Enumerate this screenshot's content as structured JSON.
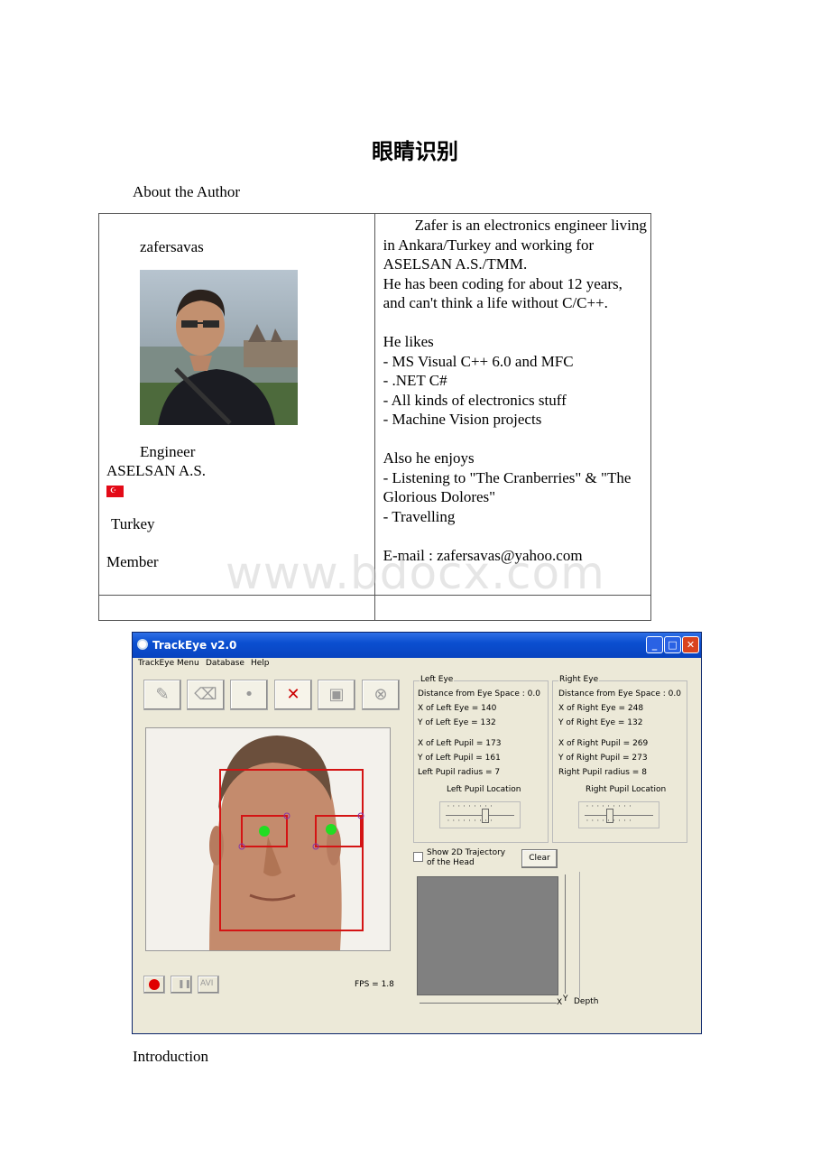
{
  "doc": {
    "title": "眼睛识别",
    "about_heading": "About the Author",
    "intro_heading": "Introduction",
    "watermark": "www.bdocx.com"
  },
  "author": {
    "username": "zafersavas",
    "job": "Engineer",
    "company": "ASELSAN A.S.",
    "country": "Turkey",
    "role": "Member",
    "bio": [
      "Zafer is an electronics engineer living in Ankara/Turkey and working for ASELSAN A.S./TMM.",
      "He has been coding for about 12 years, and can't think a life without C/C++.",
      "He likes",
      "- MS Visual C++ 6.0 and MFC",
      "- .NET C#",
      "- All kinds of electronics stuff",
      "- Machine Vision projects",
      "Also he enjoys",
      "- Listening to \"The Cranberries\" & \"The Glorious Dolores\"",
      "- Travelling",
      "E-mail : zafersavas@yahoo.com"
    ]
  },
  "app": {
    "title": "TrackEye v2.0",
    "menu": [
      "TrackEye Menu",
      "Database",
      "Help"
    ],
    "fps": "FPS = 1.8",
    "avi_label": "AVI",
    "left_eye": {
      "label": "Left Eye",
      "distance": "Distance from Eye Space : 0.0",
      "x_eye": "X of Left Eye =    140",
      "y_eye": "Y of Left Eye =    132",
      "x_pupil": "X of Left Pupil =   173",
      "y_pupil": "Y of Left Pupil =   161",
      "radius": "Left Pupil radius =   7",
      "location": "Left Pupil Location"
    },
    "right_eye": {
      "label": "Right Eye",
      "distance": "Distance from Eye Space : 0.0",
      "x_eye": "X of Right Eye =    248",
      "y_eye": "Y of Right Eye =    132",
      "x_pupil": "X of Right Pupil =   269",
      "y_pupil": "Y of Right Pupil =   273",
      "radius": "Right Pupil radius =   8",
      "location": "Right Pupil Location"
    },
    "trajectory_label_1": "Show 2D Trajectory",
    "trajectory_label_2": "of the Head",
    "clear_label": "Clear",
    "axis_x": "X",
    "axis_y": "Y",
    "axis_depth": "Depth",
    "colors": {
      "titlebar": "#0b4fd0",
      "face_box": "#d41414",
      "pupil": "#22dd22",
      "record": "#e00000"
    }
  }
}
